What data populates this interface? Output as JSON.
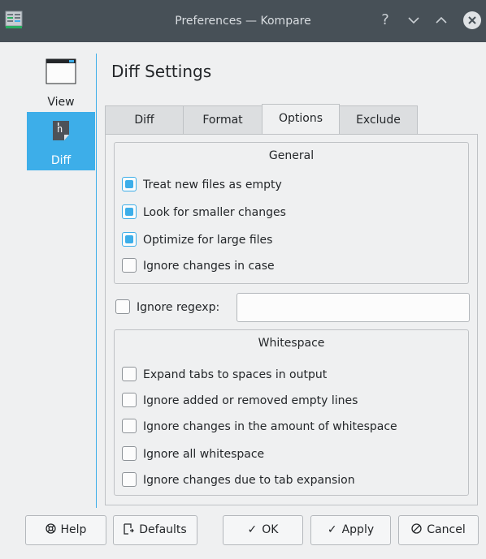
{
  "window": {
    "title": "Preferences — Kompare",
    "controls": [
      "?",
      "⌄",
      "⌃"
    ]
  },
  "sidebar": {
    "items": [
      {
        "label": "View",
        "icon": "window-icon",
        "active": false
      },
      {
        "label": "Diff",
        "icon": "diff-document-icon",
        "active": true
      }
    ]
  },
  "page": {
    "title": "Diff Settings"
  },
  "tabs": [
    {
      "label": "Diff",
      "active": false
    },
    {
      "label": "Format",
      "active": false
    },
    {
      "label": "Options",
      "active": true
    },
    {
      "label": "Exclude",
      "active": false
    }
  ],
  "general": {
    "title": "General",
    "options": [
      {
        "label": "Treat new files as empty",
        "checked": true
      },
      {
        "label": "Look for smaller changes",
        "checked": true
      },
      {
        "label": "Optimize for large files",
        "checked": true
      },
      {
        "label": "Ignore changes in case",
        "checked": false
      }
    ]
  },
  "regexp": {
    "label": "Ignore regexp:",
    "checked": false,
    "value": ""
  },
  "whitespace": {
    "title": "Whitespace",
    "options": [
      {
        "label": "Expand tabs to spaces in output",
        "checked": false
      },
      {
        "label": "Ignore added or removed empty lines",
        "checked": false
      },
      {
        "label": "Ignore changes in the amount of whitespace",
        "checked": false
      },
      {
        "label": "Ignore all whitespace",
        "checked": false
      },
      {
        "label": "Ignore changes due to tab expansion",
        "checked": false
      }
    ]
  },
  "buttons": {
    "help": "Help",
    "defaults": "Defaults",
    "ok": "OK",
    "apply": "Apply",
    "cancel": "Cancel"
  },
  "colors": {
    "accent": "#3daee9",
    "titlebar": "#475057",
    "background": "#eff0f1"
  }
}
